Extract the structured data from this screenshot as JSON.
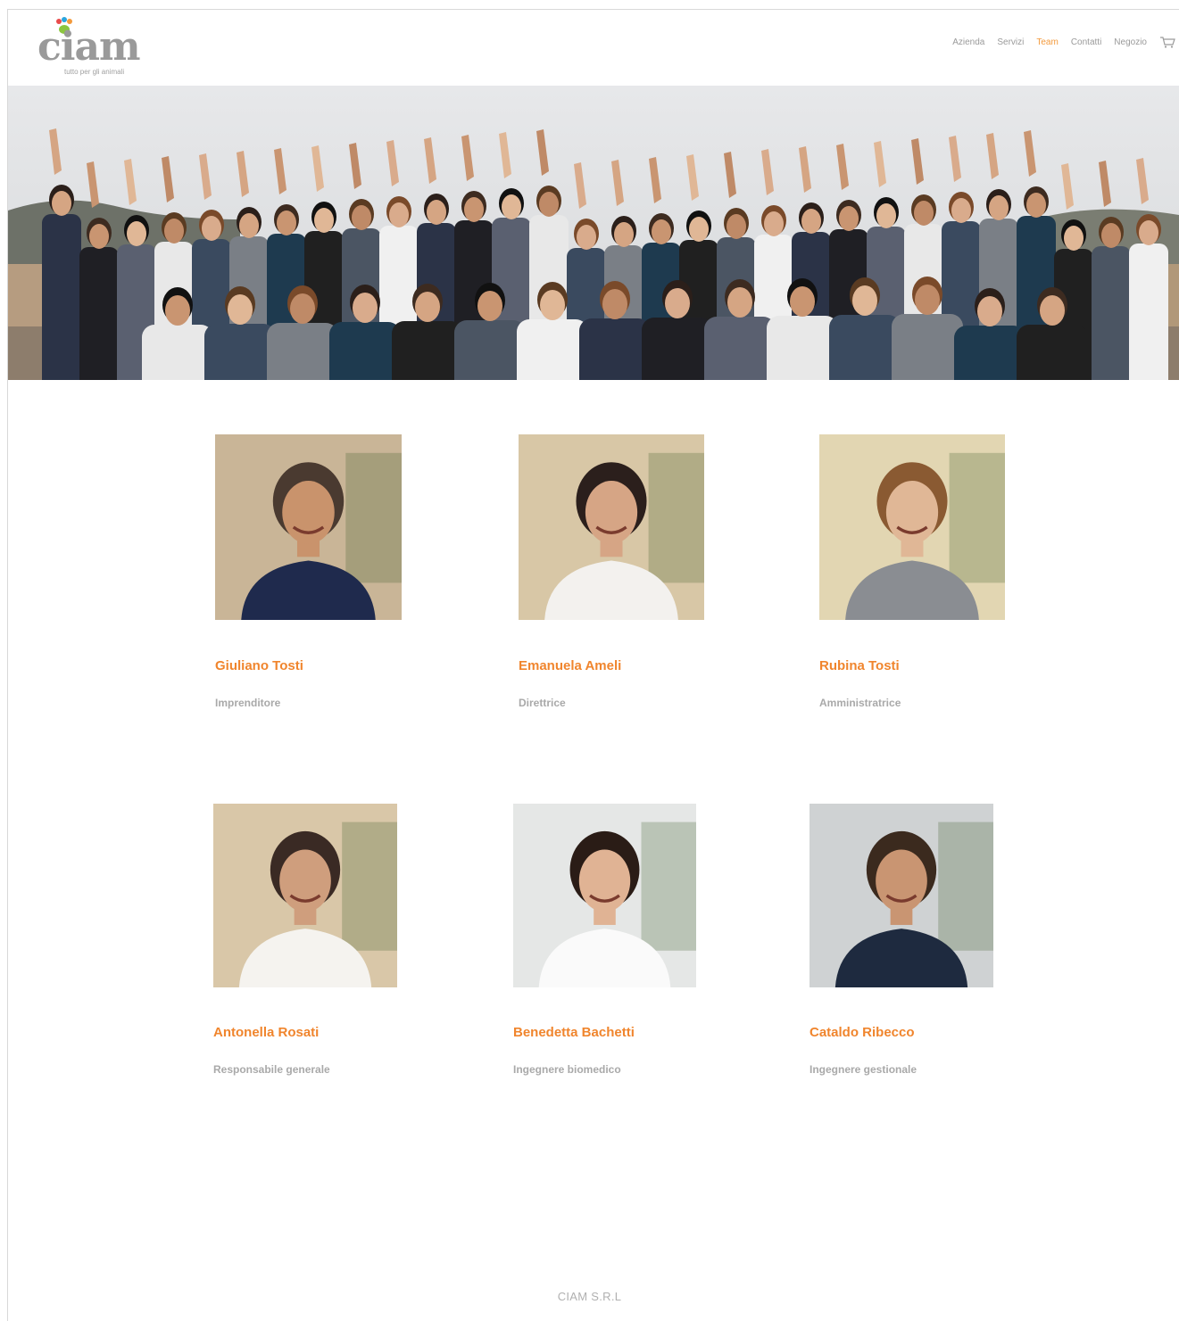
{
  "brand": {
    "wordmark": "ciam",
    "tagline": "tutto per gli animali",
    "paw_colors": [
      "#e94b4b",
      "#2aa6df",
      "#f39a3c",
      "#8cc63f"
    ]
  },
  "nav": {
    "items": [
      {
        "label": "Azienda",
        "active": false
      },
      {
        "label": "Servizi",
        "active": false
      },
      {
        "label": "Team",
        "active": true
      },
      {
        "label": "Contatti",
        "active": false
      },
      {
        "label": "Negozio",
        "active": false
      }
    ],
    "cart_icon": "cart-icon"
  },
  "hero": {
    "alt": "team-group-photo"
  },
  "team": [
    {
      "name": "Giuliano Tosti",
      "role": "Imprenditore",
      "bg": "#c9b597",
      "skin": "#c9936c",
      "hair": "#4a3a30",
      "shirt": "#1f2a4d"
    },
    {
      "name": "Emanuela Ameli",
      "role": "Direttrice",
      "bg": "#d8c7a6",
      "skin": "#d6a585",
      "hair": "#2b1f1c",
      "shirt": "#f3f1ee"
    },
    {
      "name": "Rubina Tosti",
      "role": "Amministratrice",
      "bg": "#e2d6b2",
      "skin": "#e0b796",
      "hair": "#8a5a32",
      "shirt": "#8a8d92"
    },
    {
      "name": "Antonella Rosati",
      "role": "Responsabile generale",
      "bg": "#d9c7a8",
      "skin": "#cf9e7d",
      "hair": "#3a2a24",
      "shirt": "#f5f3ef"
    },
    {
      "name": "Benedetta Bachetti",
      "role": "Ingegnere biomedico",
      "bg": "#e5e7e6",
      "skin": "#e0b394",
      "hair": "#2a1c16",
      "shirt": "#fafafa"
    },
    {
      "name": "Cataldo Ribecco",
      "role": "Ingegnere gestionale",
      "bg": "#cfd2d3",
      "skin": "#c99572",
      "hair": "#3b2a1e",
      "shirt": "#1e2a3f"
    }
  ],
  "footer": {
    "text": "CIAM S.R.L"
  }
}
